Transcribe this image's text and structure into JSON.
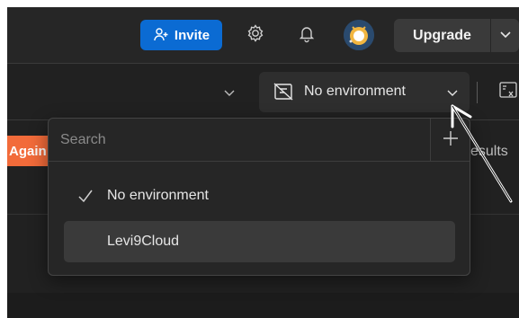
{
  "topbar": {
    "invite_label": "Invite",
    "upgrade_label": "Upgrade",
    "invite_color": "#0b6bd3"
  },
  "environment": {
    "selected": "No environment"
  },
  "background": {
    "send_again_label": "Again",
    "results_label": "esults",
    "send_again_color": "#f26b3a"
  },
  "dropdown": {
    "search_placeholder": "Search",
    "options": [
      {
        "label": "No environment",
        "checked": true
      },
      {
        "label": "Levi9Cloud",
        "checked": false,
        "hovered": true
      }
    ]
  },
  "icons": [
    "person-plus-icon",
    "gear-icon",
    "bell-icon",
    "avatar",
    "chevron-down-icon",
    "no-environment-icon",
    "variables-icon",
    "plus-icon",
    "check-icon"
  ]
}
